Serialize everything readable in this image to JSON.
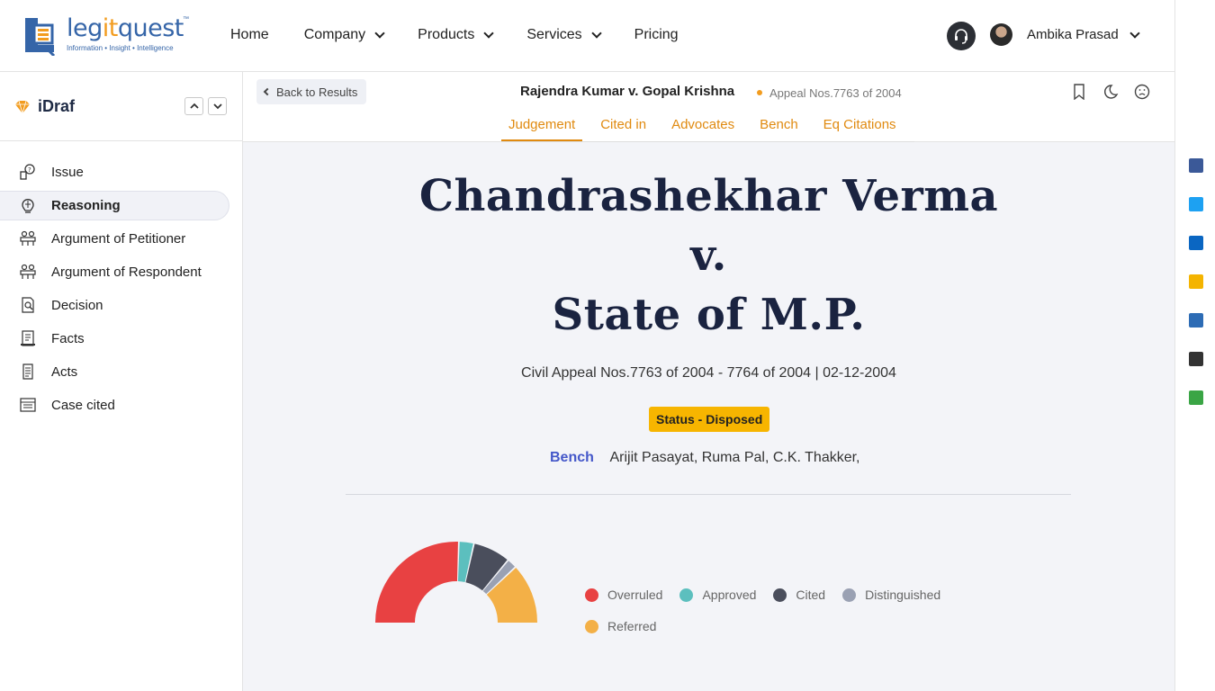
{
  "header": {
    "logo": {
      "word_a": "leg",
      "word_b": "it",
      "word_c": "quest",
      "tm": "™",
      "tagline": "Information • Insight • Intelligence"
    },
    "nav": [
      {
        "label": "Home",
        "dropdown": false
      },
      {
        "label": "Company",
        "dropdown": true
      },
      {
        "label": "Products",
        "dropdown": true
      },
      {
        "label": "Services",
        "dropdown": true
      },
      {
        "label": "Pricing",
        "dropdown": false
      }
    ],
    "user_name": "Ambika Prasad"
  },
  "sidebar": {
    "title": "iDraf",
    "items": [
      {
        "label": "Issue",
        "icon": "issue-icon"
      },
      {
        "label": "Reasoning",
        "icon": "reasoning-icon",
        "active": true
      },
      {
        "label": "Argument of Petitioner",
        "icon": "petitioner-icon"
      },
      {
        "label": "Argument of Respondent",
        "icon": "respondent-icon"
      },
      {
        "label": "Decision",
        "icon": "decision-icon"
      },
      {
        "label": "Facts",
        "icon": "facts-icon"
      },
      {
        "label": "Acts",
        "icon": "acts-icon"
      },
      {
        "label": "Case cited",
        "icon": "case-cited-icon"
      }
    ]
  },
  "subheader": {
    "back_label": "Back to Results",
    "case_title": "Rajendra Kumar v. Gopal Krishna",
    "case_ref": "Appeal Nos.7763 of 2004",
    "tabs": [
      "Judgement",
      "Cited in",
      "Advocates",
      "Bench",
      "Eq Citations"
    ],
    "active_tab": "Judgement"
  },
  "judgement": {
    "party_1": "Chandrashekhar Verma",
    "versus": "v.",
    "party_2": "State of M.P.",
    "citation": "Civil Appeal Nos.7763 of 2004 - 7764 of 2004 | 02-12-2004",
    "status": "Status - Disposed",
    "bench_label": "Bench",
    "bench_judges": "Arijit Pasayat, Ruma Pal, C.K. Thakker,"
  },
  "chart_data": {
    "type": "pie",
    "shape": "semicircle-donut",
    "series": [
      {
        "name": "Overruled",
        "value": 51,
        "color": "#e84142"
      },
      {
        "name": "Approved",
        "value": 6,
        "color": "#5cbfbe"
      },
      {
        "name": "Cited",
        "value": 15,
        "color": "#4a4e5c"
      },
      {
        "name": "Distinguished",
        "value": 4,
        "color": "#9aa1b3"
      },
      {
        "name": "Referred",
        "value": 24,
        "color": "#f3b047"
      }
    ],
    "legend_position": "right"
  },
  "share": [
    {
      "icon": "facebook-icon",
      "color": "#3b5998"
    },
    {
      "icon": "twitter-icon",
      "color": "#1da1f2"
    },
    {
      "icon": "linkedin-icon",
      "color": "#0a66c2"
    },
    {
      "icon": "email-icon",
      "color": "#f4b400"
    },
    {
      "icon": "notebook-icon",
      "color": "#2d6cb5"
    },
    {
      "icon": "print-icon",
      "color": "#333333"
    },
    {
      "icon": "evernote-icon",
      "color": "#3aa545"
    }
  ]
}
